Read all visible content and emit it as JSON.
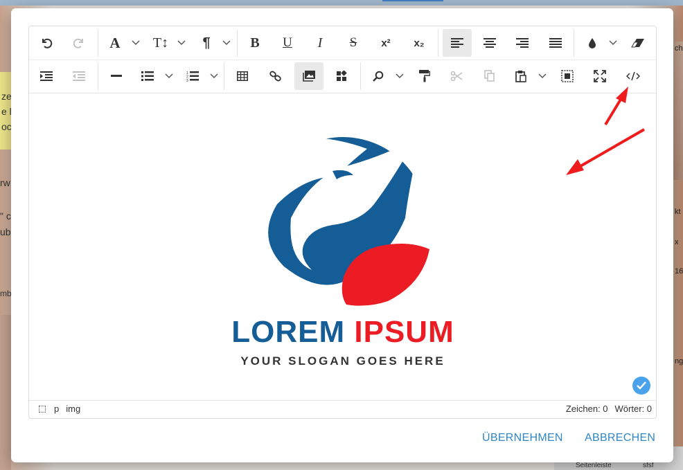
{
  "background": {
    "left_texts": [
      "ze",
      "e l",
      "oc",
      "rw",
      "\" c",
      "ub",
      "mb"
    ],
    "right_texts": [
      "cht",
      "kt",
      "x",
      "16",
      "nge"
    ],
    "bottom": {
      "left": "Seitenleiste",
      "right": "sfsf"
    }
  },
  "toolbar": {
    "row1": [
      {
        "name": "undo-button",
        "icon": "undo-icon"
      },
      {
        "name": "redo-button",
        "icon": "redo-icon",
        "disabled": true
      },
      {
        "name": "font-family-button",
        "icon": "font-icon",
        "glyph": "A",
        "dropdown": true
      },
      {
        "name": "font-size-button",
        "icon": "font-size-icon",
        "glyph": "T↕",
        "dropdown": true
      },
      {
        "name": "paragraph-format-button",
        "icon": "paragraph-icon",
        "glyph": "¶",
        "dropdown": true
      },
      {
        "name": "bold-button",
        "icon": "bold-icon",
        "glyph": "B"
      },
      {
        "name": "underline-button",
        "icon": "underline-icon",
        "glyph": "U"
      },
      {
        "name": "italic-button",
        "icon": "italic-icon",
        "glyph": "I"
      },
      {
        "name": "strikethrough-button",
        "icon": "strikethrough-icon",
        "glyph": "S"
      },
      {
        "name": "superscript-button",
        "icon": "superscript-icon",
        "glyph": "x²"
      },
      {
        "name": "subscript-button",
        "icon": "subscript-icon",
        "glyph": "x₂"
      },
      {
        "name": "align-left-button",
        "icon": "align-left-icon",
        "active": true
      },
      {
        "name": "align-center-button",
        "icon": "align-center-icon"
      },
      {
        "name": "align-right-button",
        "icon": "align-right-icon"
      },
      {
        "name": "align-justify-button",
        "icon": "align-justify-icon"
      },
      {
        "name": "text-color-button",
        "icon": "droplet-icon",
        "dropdown": true
      },
      {
        "name": "clear-formatting-button",
        "icon": "eraser-icon"
      }
    ],
    "row2": [
      {
        "name": "indent-button",
        "icon": "indent-icon"
      },
      {
        "name": "outdent-button",
        "icon": "outdent-icon",
        "disabled": true
      },
      {
        "name": "horizontal-line-button",
        "icon": "horizontal-line-icon"
      },
      {
        "name": "unordered-list-button",
        "icon": "bullet-list-icon",
        "dropdown": true
      },
      {
        "name": "ordered-list-button",
        "icon": "numbered-list-icon",
        "dropdown": true
      },
      {
        "name": "insert-table-button",
        "icon": "table-icon"
      },
      {
        "name": "insert-link-button",
        "icon": "link-icon"
      },
      {
        "name": "insert-image-button",
        "icon": "image-icon",
        "active": true
      },
      {
        "name": "insert-widget-button",
        "icon": "widgets-icon"
      },
      {
        "name": "find-replace-button",
        "icon": "search-icon",
        "dropdown": true
      },
      {
        "name": "copy-format-button",
        "icon": "paint-roller-icon"
      },
      {
        "name": "cut-button",
        "icon": "scissors-icon",
        "disabled": true
      },
      {
        "name": "copy-button",
        "icon": "copy-icon",
        "disabled": true
      },
      {
        "name": "paste-button",
        "icon": "paste-icon",
        "dropdown": true
      },
      {
        "name": "select-all-button",
        "icon": "select-all-icon"
      },
      {
        "name": "fullscreen-button",
        "icon": "fullscreen-icon"
      },
      {
        "name": "source-code-button",
        "icon": "code-icon"
      }
    ]
  },
  "logo": {
    "title_left": "LOREM",
    "title_right": "IPSUM",
    "slogan": "YOUR SLOGAN GOES HERE",
    "colors": {
      "blue": "#155d96",
      "red": "#ec1c24",
      "dark": "#333333"
    }
  },
  "statusbar": {
    "path": [
      "p",
      "img"
    ],
    "chars": "Zeichen: 0",
    "words": "Wörter: 0"
  },
  "footer": {
    "apply": "ÜBERNEHMEN",
    "cancel": "ABBRECHEN"
  },
  "colors": {
    "accent": "#2f86c8",
    "arrow": "#ee1c1c",
    "check": "#4aa3ea"
  }
}
